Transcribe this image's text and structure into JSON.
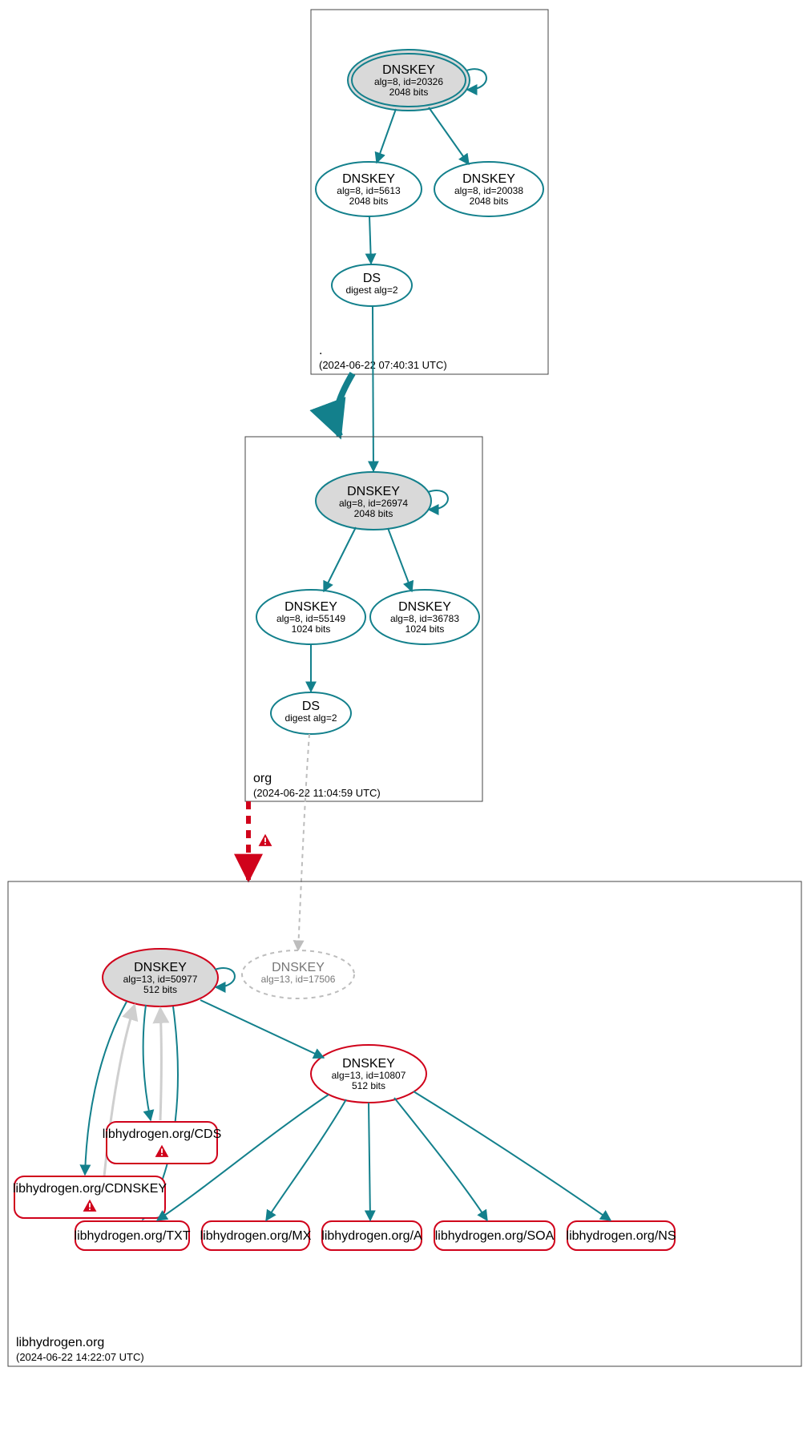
{
  "zones": {
    "root": {
      "label": ".",
      "timestamp": "(2024-06-22 07:40:31 UTC)",
      "dnskey_ksk": {
        "title": "DNSKEY",
        "alg": "alg=8, id=20326",
        "bits": "2048 bits"
      },
      "dnskey_zsk1": {
        "title": "DNSKEY",
        "alg": "alg=8, id=5613",
        "bits": "2048 bits"
      },
      "dnskey_zsk2": {
        "title": "DNSKEY",
        "alg": "alg=8, id=20038",
        "bits": "2048 bits"
      },
      "ds": {
        "title": "DS",
        "alg": "digest alg=2"
      }
    },
    "org": {
      "label": "org",
      "timestamp": "(2024-06-22 11:04:59 UTC)",
      "dnskey_ksk": {
        "title": "DNSKEY",
        "alg": "alg=8, id=26974",
        "bits": "2048 bits"
      },
      "dnskey_zsk1": {
        "title": "DNSKEY",
        "alg": "alg=8, id=55149",
        "bits": "1024 bits"
      },
      "dnskey_zsk2": {
        "title": "DNSKEY",
        "alg": "alg=8, id=36783",
        "bits": "1024 bits"
      },
      "ds": {
        "title": "DS",
        "alg": "digest alg=2"
      }
    },
    "leaf": {
      "label": "libhydrogen.org",
      "timestamp": "(2024-06-22 14:22:07 UTC)",
      "dnskey_ksk": {
        "title": "DNSKEY",
        "alg": "alg=13, id=50977",
        "bits": "512 bits"
      },
      "dnskey_ext": {
        "title": "DNSKEY",
        "alg": "alg=13, id=17506"
      },
      "dnskey_zsk": {
        "title": "DNSKEY",
        "alg": "alg=13, id=10807",
        "bits": "512 bits"
      },
      "rec_cds": "libhydrogen.org/CDS",
      "rec_cdnskey": "libhydrogen.org/CDNSKEY",
      "rec_txt": "libhydrogen.org/TXT",
      "rec_mx": "libhydrogen.org/MX",
      "rec_a": "libhydrogen.org/A",
      "rec_soa": "libhydrogen.org/SOA",
      "rec_ns": "libhydrogen.org/NS"
    }
  },
  "colors": {
    "teal": "#13808c",
    "red": "#d0021b",
    "grayFill": "#d9d9d9",
    "grayLine": "#bdbdbd",
    "lightGray": "#cfcfcf",
    "zoneBorder": "#444444"
  }
}
